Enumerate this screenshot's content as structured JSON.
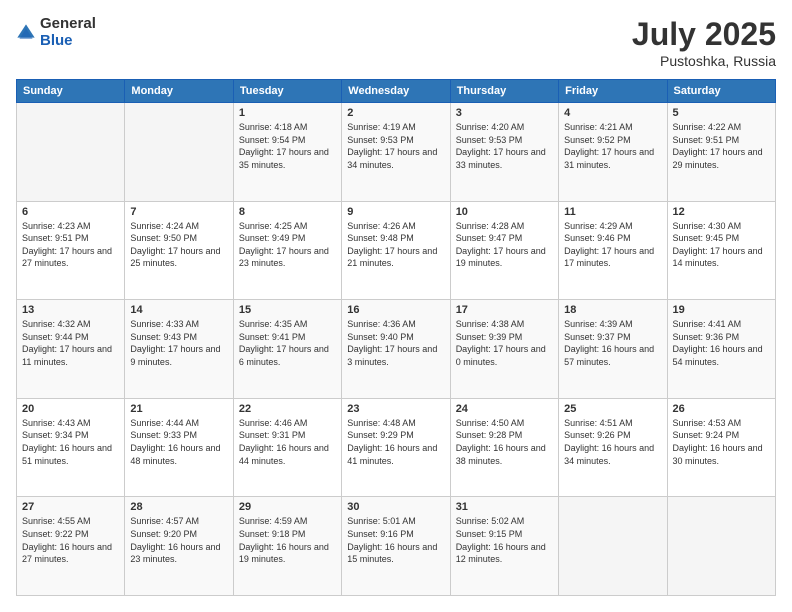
{
  "logo": {
    "general": "General",
    "blue": "Blue"
  },
  "header": {
    "title": "July 2025",
    "subtitle": "Pustoshka, Russia"
  },
  "weekdays": [
    "Sunday",
    "Monday",
    "Tuesday",
    "Wednesday",
    "Thursday",
    "Friday",
    "Saturday"
  ],
  "weeks": [
    [
      {
        "day": "",
        "detail": ""
      },
      {
        "day": "",
        "detail": ""
      },
      {
        "day": "1",
        "detail": "Sunrise: 4:18 AM\nSunset: 9:54 PM\nDaylight: 17 hours and 35 minutes."
      },
      {
        "day": "2",
        "detail": "Sunrise: 4:19 AM\nSunset: 9:53 PM\nDaylight: 17 hours and 34 minutes."
      },
      {
        "day": "3",
        "detail": "Sunrise: 4:20 AM\nSunset: 9:53 PM\nDaylight: 17 hours and 33 minutes."
      },
      {
        "day": "4",
        "detail": "Sunrise: 4:21 AM\nSunset: 9:52 PM\nDaylight: 17 hours and 31 minutes."
      },
      {
        "day": "5",
        "detail": "Sunrise: 4:22 AM\nSunset: 9:51 PM\nDaylight: 17 hours and 29 minutes."
      }
    ],
    [
      {
        "day": "6",
        "detail": "Sunrise: 4:23 AM\nSunset: 9:51 PM\nDaylight: 17 hours and 27 minutes."
      },
      {
        "day": "7",
        "detail": "Sunrise: 4:24 AM\nSunset: 9:50 PM\nDaylight: 17 hours and 25 minutes."
      },
      {
        "day": "8",
        "detail": "Sunrise: 4:25 AM\nSunset: 9:49 PM\nDaylight: 17 hours and 23 minutes."
      },
      {
        "day": "9",
        "detail": "Sunrise: 4:26 AM\nSunset: 9:48 PM\nDaylight: 17 hours and 21 minutes."
      },
      {
        "day": "10",
        "detail": "Sunrise: 4:28 AM\nSunset: 9:47 PM\nDaylight: 17 hours and 19 minutes."
      },
      {
        "day": "11",
        "detail": "Sunrise: 4:29 AM\nSunset: 9:46 PM\nDaylight: 17 hours and 17 minutes."
      },
      {
        "day": "12",
        "detail": "Sunrise: 4:30 AM\nSunset: 9:45 PM\nDaylight: 17 hours and 14 minutes."
      }
    ],
    [
      {
        "day": "13",
        "detail": "Sunrise: 4:32 AM\nSunset: 9:44 PM\nDaylight: 17 hours and 11 minutes."
      },
      {
        "day": "14",
        "detail": "Sunrise: 4:33 AM\nSunset: 9:43 PM\nDaylight: 17 hours and 9 minutes."
      },
      {
        "day": "15",
        "detail": "Sunrise: 4:35 AM\nSunset: 9:41 PM\nDaylight: 17 hours and 6 minutes."
      },
      {
        "day": "16",
        "detail": "Sunrise: 4:36 AM\nSunset: 9:40 PM\nDaylight: 17 hours and 3 minutes."
      },
      {
        "day": "17",
        "detail": "Sunrise: 4:38 AM\nSunset: 9:39 PM\nDaylight: 17 hours and 0 minutes."
      },
      {
        "day": "18",
        "detail": "Sunrise: 4:39 AM\nSunset: 9:37 PM\nDaylight: 16 hours and 57 minutes."
      },
      {
        "day": "19",
        "detail": "Sunrise: 4:41 AM\nSunset: 9:36 PM\nDaylight: 16 hours and 54 minutes."
      }
    ],
    [
      {
        "day": "20",
        "detail": "Sunrise: 4:43 AM\nSunset: 9:34 PM\nDaylight: 16 hours and 51 minutes."
      },
      {
        "day": "21",
        "detail": "Sunrise: 4:44 AM\nSunset: 9:33 PM\nDaylight: 16 hours and 48 minutes."
      },
      {
        "day": "22",
        "detail": "Sunrise: 4:46 AM\nSunset: 9:31 PM\nDaylight: 16 hours and 44 minutes."
      },
      {
        "day": "23",
        "detail": "Sunrise: 4:48 AM\nSunset: 9:29 PM\nDaylight: 16 hours and 41 minutes."
      },
      {
        "day": "24",
        "detail": "Sunrise: 4:50 AM\nSunset: 9:28 PM\nDaylight: 16 hours and 38 minutes."
      },
      {
        "day": "25",
        "detail": "Sunrise: 4:51 AM\nSunset: 9:26 PM\nDaylight: 16 hours and 34 minutes."
      },
      {
        "day": "26",
        "detail": "Sunrise: 4:53 AM\nSunset: 9:24 PM\nDaylight: 16 hours and 30 minutes."
      }
    ],
    [
      {
        "day": "27",
        "detail": "Sunrise: 4:55 AM\nSunset: 9:22 PM\nDaylight: 16 hours and 27 minutes."
      },
      {
        "day": "28",
        "detail": "Sunrise: 4:57 AM\nSunset: 9:20 PM\nDaylight: 16 hours and 23 minutes."
      },
      {
        "day": "29",
        "detail": "Sunrise: 4:59 AM\nSunset: 9:18 PM\nDaylight: 16 hours and 19 minutes."
      },
      {
        "day": "30",
        "detail": "Sunrise: 5:01 AM\nSunset: 9:16 PM\nDaylight: 16 hours and 15 minutes."
      },
      {
        "day": "31",
        "detail": "Sunrise: 5:02 AM\nSunset: 9:15 PM\nDaylight: 16 hours and 12 minutes."
      },
      {
        "day": "",
        "detail": ""
      },
      {
        "day": "",
        "detail": ""
      }
    ]
  ]
}
